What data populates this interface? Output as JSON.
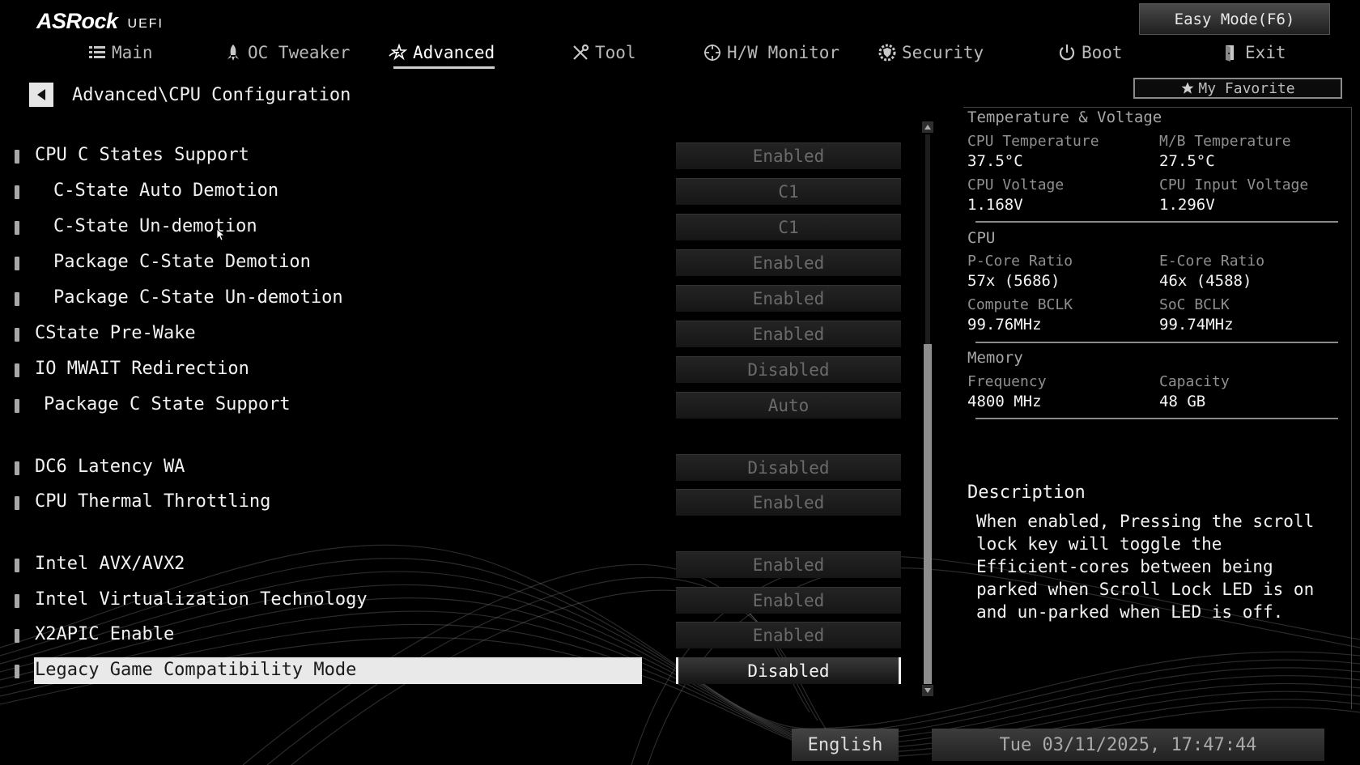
{
  "brand": {
    "name": "ASRock",
    "suffix": "UEFI"
  },
  "easy_mode": "Easy Mode(F6)",
  "nav": {
    "tabs": [
      {
        "label": "Main",
        "icon": "list-icon"
      },
      {
        "label": "OC Tweaker",
        "icon": "rocket-icon"
      },
      {
        "label": "Advanced",
        "icon": "star-swoosh-icon",
        "active": true
      },
      {
        "label": "Tool",
        "icon": "tools-icon"
      },
      {
        "label": "H/W Monitor",
        "icon": "crosshair-icon"
      },
      {
        "label": "Security",
        "icon": "shield-gear-icon"
      },
      {
        "label": "Boot",
        "icon": "power-icon"
      },
      {
        "label": "Exit",
        "icon": "door-exit-icon"
      }
    ]
  },
  "breadcrumb": "Advanced\\CPU Configuration",
  "favorite": "My Favorite",
  "settings": [
    {
      "label": "CPU C States Support",
      "value": "Enabled"
    },
    {
      "label": "C-State Auto Demotion",
      "value": "C1"
    },
    {
      "label": "C-State Un-demotion",
      "value": "C1"
    },
    {
      "label": "Package C-State Demotion",
      "value": "Enabled"
    },
    {
      "label": "Package C-State Un-demotion",
      "value": "Enabled"
    },
    {
      "label": "CState Pre-Wake",
      "value": "Enabled"
    },
    {
      "label": "IO MWAIT Redirection",
      "value": "Disabled"
    },
    {
      "label": "Package C State Support",
      "value": "Auto"
    },
    {
      "label": "DC6 Latency WA",
      "value": "Disabled"
    },
    {
      "label": "CPU Thermal Throttling",
      "value": "Enabled"
    },
    {
      "label": "Intel AVX/AVX2",
      "value": "Enabled"
    },
    {
      "label": "Intel Virtualization Technology",
      "value": "Enabled"
    },
    {
      "label": "X2APIC Enable",
      "value": "Enabled"
    },
    {
      "label": "Legacy Game Compatibility Mode",
      "value": "Disabled",
      "selected": true
    }
  ],
  "monitor": {
    "temp_voltage": {
      "title": "Temperature & Voltage",
      "cpu_temp_label": "CPU Temperature",
      "cpu_temp": "37.5°C",
      "mb_temp_label": "M/B Temperature",
      "mb_temp": "27.5°C",
      "cpu_volt_label": "CPU Voltage",
      "cpu_volt": "1.168V",
      "cpu_in_volt_label": "CPU Input Voltage",
      "cpu_in_volt": "1.296V"
    },
    "cpu": {
      "title": "CPU",
      "pcore_label": "P-Core Ratio",
      "pcore": "57x (5686)",
      "ecore_label": "E-Core Ratio",
      "ecore": "46x (4588)",
      "bclk_label": "Compute BCLK",
      "bclk": "99.76MHz",
      "soc_label": "SoC BCLK",
      "soc": "99.74MHz"
    },
    "memory": {
      "title": "Memory",
      "freq_label": "Frequency",
      "freq": "4800 MHz",
      "cap_label": "Capacity",
      "cap": "48 GB"
    }
  },
  "description": {
    "title": "Description",
    "text": "When enabled, Pressing the scroll lock key will toggle the Efficient-cores between being parked when Scroll Lock LED is on and un-parked when LED is off."
  },
  "footer": {
    "language": "English",
    "datetime": "Tue 03/11/2025, 17:47:44"
  }
}
